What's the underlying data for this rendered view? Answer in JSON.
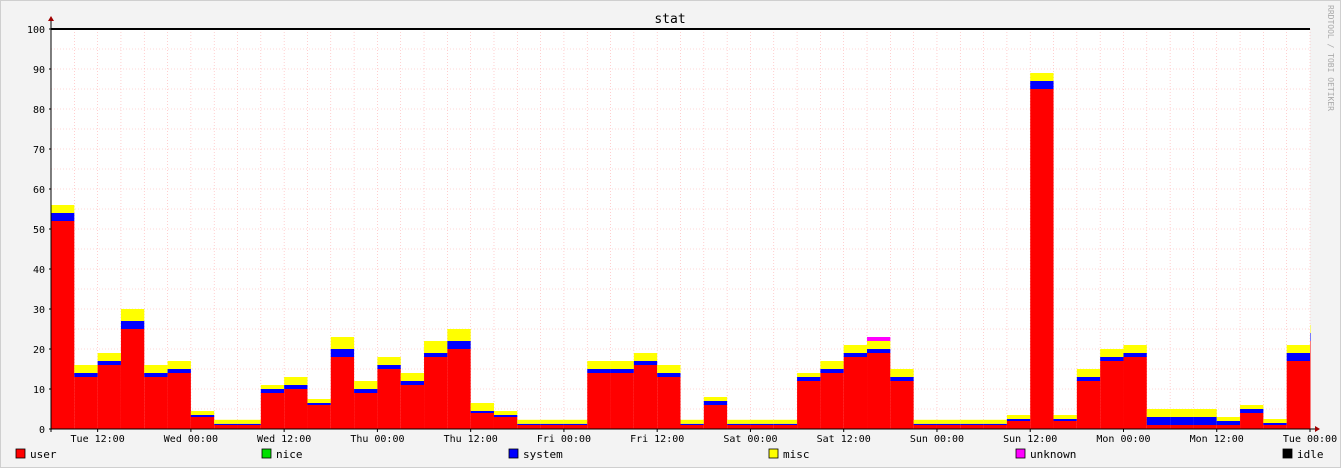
{
  "watermark": "RRDTOOL / TOBI OETIKER",
  "chart_data": {
    "type": "area",
    "title": "stat",
    "xlabel": "",
    "ylabel": "",
    "ylim": [
      0,
      100
    ],
    "y_ticks": [
      0,
      10,
      20,
      30,
      40,
      50,
      60,
      70,
      80,
      90,
      100
    ],
    "x_range": [
      "Tue 06:00",
      "Tue 00:00 (+1 week)"
    ],
    "x_ticks": [
      "Tue 12:00",
      "Wed 00:00",
      "Wed 12:00",
      "Thu 00:00",
      "Thu 12:00",
      "Fri 00:00",
      "Fri 12:00",
      "Sat 00:00",
      "Sat 12:00",
      "Sun 00:00",
      "Sun 12:00",
      "Mon 00:00",
      "Mon 12:00",
      "Tue 00:00"
    ],
    "x_hours": [
      0,
      3,
      6,
      9,
      12,
      15,
      18,
      21,
      24,
      27,
      30,
      33,
      36,
      39,
      42,
      45,
      48,
      51,
      54,
      57,
      60,
      63,
      66,
      69,
      72,
      75,
      78,
      81,
      84,
      87,
      90,
      93,
      96,
      99,
      102,
      105,
      108,
      111,
      114,
      117,
      120,
      123,
      126,
      129,
      132,
      135,
      138,
      141,
      144,
      147,
      150,
      153,
      156,
      159,
      162
    ],
    "grid": true,
    "legend_position": "bottom",
    "series": [
      {
        "name": "user",
        "color": "#ff0000",
        "values": [
          52,
          13,
          16,
          25,
          13,
          14,
          3,
          1,
          1,
          9,
          10,
          6,
          18,
          9,
          15,
          11,
          18,
          20,
          4,
          3,
          1,
          1,
          1,
          14,
          14,
          16,
          13,
          1,
          6,
          1,
          1,
          1,
          12,
          14,
          18,
          19,
          12,
          1,
          1,
          1,
          1,
          2,
          85,
          2,
          12,
          17,
          18,
          1,
          1,
          1,
          1,
          4,
          1,
          17,
          22
        ]
      },
      {
        "name": "nice",
        "color": "#00e000",
        "values": [
          0,
          0,
          0,
          0,
          0,
          0,
          0,
          0,
          0,
          0,
          0,
          0,
          0,
          0,
          0,
          0,
          0,
          0,
          0,
          0,
          0,
          0,
          0,
          0,
          0,
          0,
          0,
          0,
          0,
          0,
          0,
          0,
          0,
          0,
          0,
          0,
          0,
          0,
          0,
          0,
          0,
          0,
          0,
          0,
          0,
          0,
          0,
          0,
          0,
          0,
          0,
          0,
          0,
          0,
          0
        ]
      },
      {
        "name": "system",
        "color": "#0000ff",
        "values": [
          2,
          1,
          1,
          2,
          1,
          1,
          0.5,
          0.3,
          0.3,
          1,
          1,
          0.5,
          2,
          1,
          1,
          1,
          1,
          2,
          0.5,
          0.5,
          0.3,
          0.3,
          0.3,
          1,
          1,
          1,
          1,
          0.3,
          1,
          0.3,
          0.3,
          0.3,
          1,
          1,
          1,
          1,
          1,
          0.3,
          0.3,
          0.3,
          0.3,
          0.5,
          2,
          0.5,
          1,
          1,
          1,
          2,
          2,
          2,
          1,
          1,
          0.5,
          2,
          2
        ]
      },
      {
        "name": "misc",
        "color": "#ffff00",
        "values": [
          2,
          2,
          2,
          3,
          2,
          2,
          1,
          1,
          1,
          1,
          2,
          1,
          3,
          2,
          2,
          2,
          3,
          3,
          2,
          1,
          1,
          1,
          1,
          2,
          2,
          2,
          2,
          1,
          1,
          1,
          1,
          1,
          1,
          2,
          2,
          2,
          2,
          1,
          1,
          1,
          1,
          1,
          2,
          1,
          2,
          2,
          2,
          2,
          2,
          2,
          1,
          1,
          1,
          2,
          2
        ]
      },
      {
        "name": "unknown",
        "color": "#ff00ff",
        "values": [
          0,
          0,
          0,
          0,
          0,
          0,
          0,
          0,
          0,
          0,
          0,
          0,
          0,
          0,
          0,
          0,
          0,
          0,
          0,
          0,
          0,
          0,
          0,
          0,
          0,
          0,
          0,
          0,
          0,
          0,
          0,
          0,
          0,
          0,
          0,
          1,
          0,
          0,
          0,
          0,
          0,
          0,
          0,
          0,
          0,
          0,
          0,
          0,
          0,
          0,
          0,
          0,
          0,
          0,
          0
        ]
      },
      {
        "name": "idle",
        "color": "#000000",
        "values": [
          44,
          84,
          81,
          70,
          84,
          83,
          95.5,
          97.7,
          97.7,
          89,
          87,
          92.5,
          77,
          88,
          82,
          86,
          78,
          75,
          93.5,
          95.5,
          97.7,
          97.7,
          97.7,
          83,
          83,
          81,
          84,
          97.7,
          92,
          97.7,
          97.7,
          97.7,
          86,
          83,
          79,
          77,
          85,
          97.7,
          97.7,
          97.7,
          97.7,
          96.5,
          11,
          96.5,
          85,
          80,
          79,
          95,
          95,
          95,
          97,
          94,
          97.5,
          79,
          74
        ]
      }
    ]
  }
}
